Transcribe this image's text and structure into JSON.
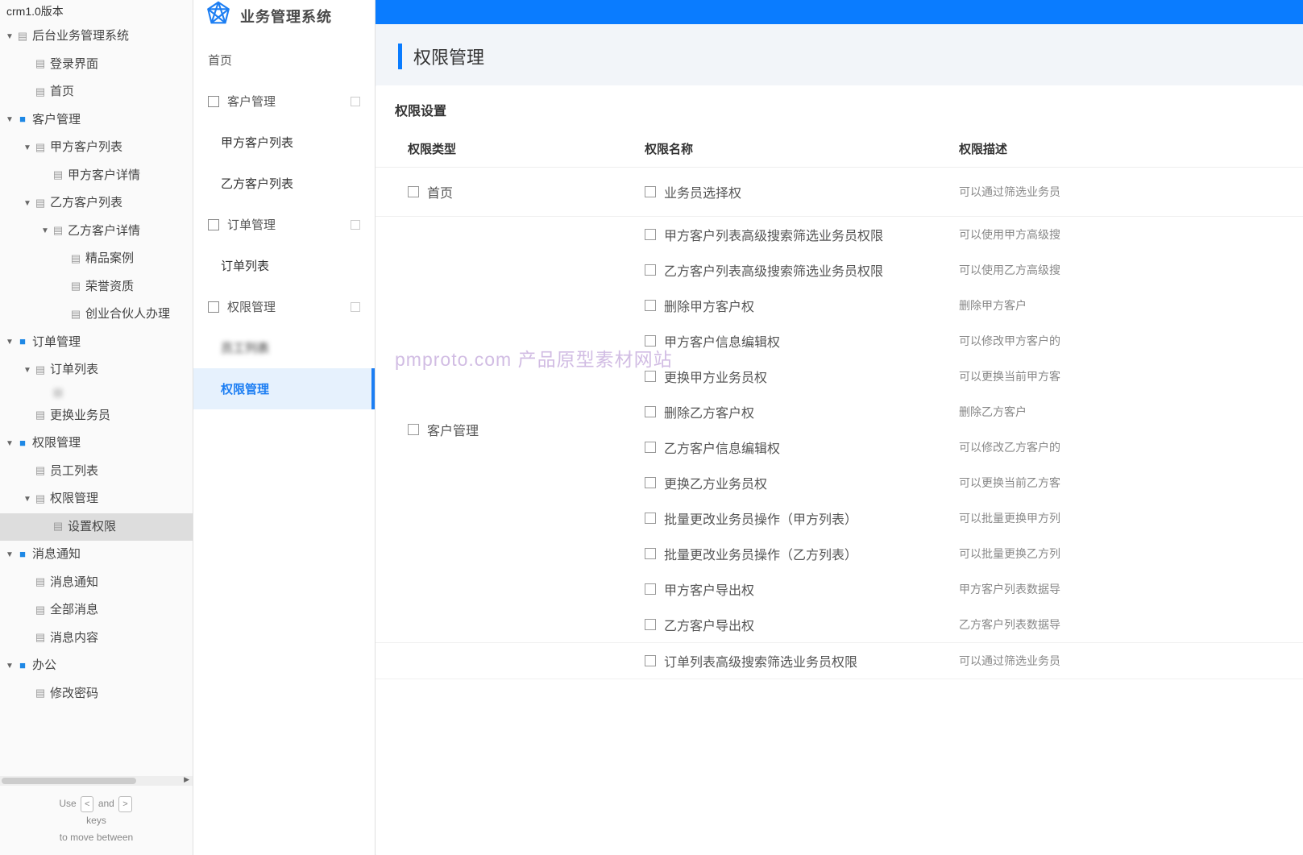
{
  "watermark": "pmproto.com 产品原型素材网站",
  "tree": {
    "title": "crm1.0版本",
    "hint_use": "Use",
    "hint_and": "and",
    "hint_keys": "keys",
    "hint_move": "to move between",
    "items": [
      {
        "indent": 0,
        "caret": "▼",
        "icon": "page",
        "label": "后台业务管理系统"
      },
      {
        "indent": 1,
        "caret": "",
        "icon": "page",
        "label": "登录界面"
      },
      {
        "indent": 1,
        "caret": "",
        "icon": "page",
        "label": "首页"
      },
      {
        "indent": 0,
        "caret": "▼",
        "icon": "folder",
        "label": "客户管理"
      },
      {
        "indent": 1,
        "caret": "▼",
        "icon": "page",
        "label": "甲方客户列表"
      },
      {
        "indent": 2,
        "caret": "",
        "icon": "page",
        "label": "甲方客户详情"
      },
      {
        "indent": 1,
        "caret": "▼",
        "icon": "page",
        "label": "乙方客户列表"
      },
      {
        "indent": 2,
        "caret": "▼",
        "icon": "page",
        "label": "乙方客户详情"
      },
      {
        "indent": 3,
        "caret": "",
        "icon": "page",
        "label": "精品案例"
      },
      {
        "indent": 3,
        "caret": "",
        "icon": "page",
        "label": "荣誉资质"
      },
      {
        "indent": 3,
        "caret": "",
        "icon": "page",
        "label": "创业合伙人办理"
      },
      {
        "indent": 0,
        "caret": "▼",
        "icon": "folder",
        "label": "订单管理"
      },
      {
        "indent": 1,
        "caret": "▼",
        "icon": "page",
        "label": "订单列表"
      },
      {
        "indent": 2,
        "caret": "",
        "icon": "page",
        "label": "",
        "blur": true
      },
      {
        "indent": 1,
        "caret": "",
        "icon": "page",
        "label": "更换业务员"
      },
      {
        "indent": 0,
        "caret": "▼",
        "icon": "folder",
        "label": "权限管理"
      },
      {
        "indent": 1,
        "caret": "",
        "icon": "page",
        "label": "员工列表"
      },
      {
        "indent": 1,
        "caret": "▼",
        "icon": "page",
        "label": "权限管理"
      },
      {
        "indent": 2,
        "caret": "",
        "icon": "page",
        "label": "设置权限",
        "selected": true
      },
      {
        "indent": 0,
        "caret": "▼",
        "icon": "folder",
        "label": "消息通知"
      },
      {
        "indent": 1,
        "caret": "",
        "icon": "page",
        "label": "消息通知"
      },
      {
        "indent": 1,
        "caret": "",
        "icon": "page",
        "label": "全部消息"
      },
      {
        "indent": 1,
        "caret": "",
        "icon": "page",
        "label": "消息内容"
      },
      {
        "indent": 0,
        "caret": "▼",
        "icon": "folder",
        "label": "办公"
      },
      {
        "indent": 1,
        "caret": "",
        "icon": "page",
        "label": "修改密码"
      }
    ]
  },
  "nav": {
    "system_title": "业务管理系统",
    "items": [
      {
        "kind": "top",
        "label": "首页"
      },
      {
        "kind": "group",
        "label": "客户管理"
      },
      {
        "kind": "sub",
        "label": "甲方客户列表"
      },
      {
        "kind": "sub",
        "label": "乙方客户列表"
      },
      {
        "kind": "group",
        "label": "订单管理"
      },
      {
        "kind": "sub",
        "label": "订单列表"
      },
      {
        "kind": "group",
        "label": "权限管理"
      },
      {
        "kind": "sub",
        "label": "员工列表",
        "blur": true
      },
      {
        "kind": "sub",
        "label": "权限管理",
        "active": true
      }
    ]
  },
  "page": {
    "title": "权限管理",
    "card_title": "权限设置",
    "columns": {
      "type": "权限类型",
      "name": "权限名称",
      "desc": "权限描述"
    },
    "groups": [
      {
        "type": "首页",
        "single": true,
        "perms": [
          {
            "name": "业务员选择权",
            "desc": "可以通过筛选业务员"
          }
        ]
      },
      {
        "type": "客户管理",
        "perms": [
          {
            "name": "甲方客户列表高级搜索筛选业务员权限",
            "desc": "可以使用甲方高级搜"
          },
          {
            "name": "乙方客户列表高级搜索筛选业务员权限",
            "desc": "可以使用乙方高级搜"
          },
          {
            "name": "删除甲方客户权",
            "desc": "删除甲方客户"
          },
          {
            "name": "甲方客户信息编辑权",
            "desc": "可以修改甲方客户的"
          },
          {
            "name": "更换甲方业务员权",
            "desc": "可以更换当前甲方客"
          },
          {
            "name": "删除乙方客户权",
            "desc": "删除乙方客户"
          },
          {
            "name": "乙方客户信息编辑权",
            "desc": "可以修改乙方客户的"
          },
          {
            "name": "更换乙方业务员权",
            "desc": "可以更换当前乙方客"
          },
          {
            "name": "批量更改业务员操作（甲方列表）",
            "desc": "可以批量更换甲方列"
          },
          {
            "name": "批量更改业务员操作（乙方列表）",
            "desc": "可以批量更换乙方列"
          },
          {
            "name": "甲方客户导出权",
            "desc": "甲方客户列表数据导"
          },
          {
            "name": "乙方客户导出权",
            "desc": "乙方客户列表数据导"
          }
        ]
      },
      {
        "type": "",
        "perms": [
          {
            "name": "订单列表高级搜索筛选业务员权限",
            "desc": "可以通过筛选业务员"
          }
        ]
      }
    ]
  }
}
